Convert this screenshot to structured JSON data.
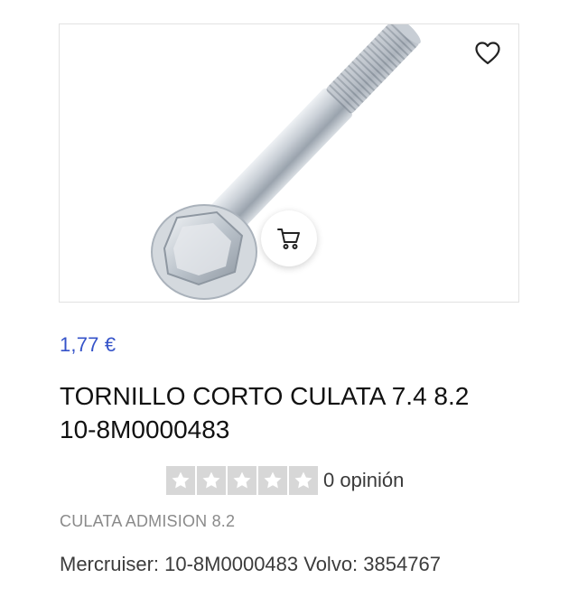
{
  "product": {
    "price": "1,77 €",
    "title": "TORNILLO CORTO CULATA 7.4 8.2 10-8M0000483",
    "rating": {
      "stars_filled": 0,
      "stars_total": 5,
      "reviews_label": "0 opinión"
    },
    "category": "CULATA ADMISION 8.2",
    "references": "Mercruiser: 10-8M0000483 Volvo: 3854767"
  },
  "icons": {
    "wishlist": "heart-outline-icon",
    "cart": "shopping-cart-icon",
    "star": "star-icon"
  },
  "colors": {
    "price": "#3553c9",
    "star_background": "#d7d7d7",
    "category_text": "#8a8a8a"
  }
}
